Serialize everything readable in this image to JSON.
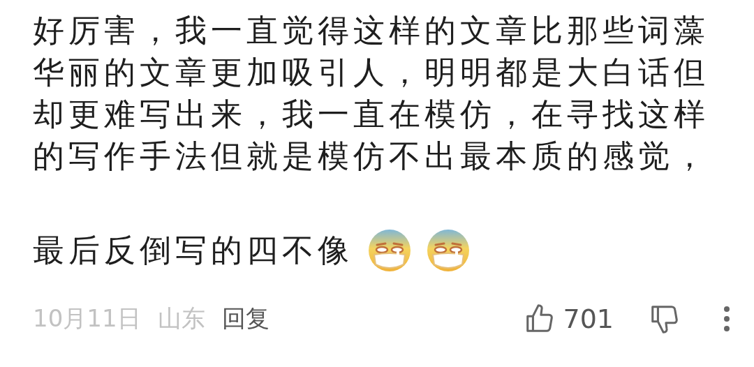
{
  "comment": {
    "lines": [
      "好厉害，我一直觉得这样的文章比那些词藻",
      "华丽的文章更加吸引人，明明都是大白话但",
      "却更难写出来，我一直在模仿，在寻找这样",
      "的写作手法但就是模仿不出最本质的感觉，",
      "最后反倒写的四不像"
    ],
    "emojis": [
      {
        "kind": "mask-face"
      },
      {
        "kind": "mask-face"
      }
    ]
  },
  "footer": {
    "date": "10月11日",
    "location": "山东",
    "reply": "回复",
    "likes": "701"
  }
}
